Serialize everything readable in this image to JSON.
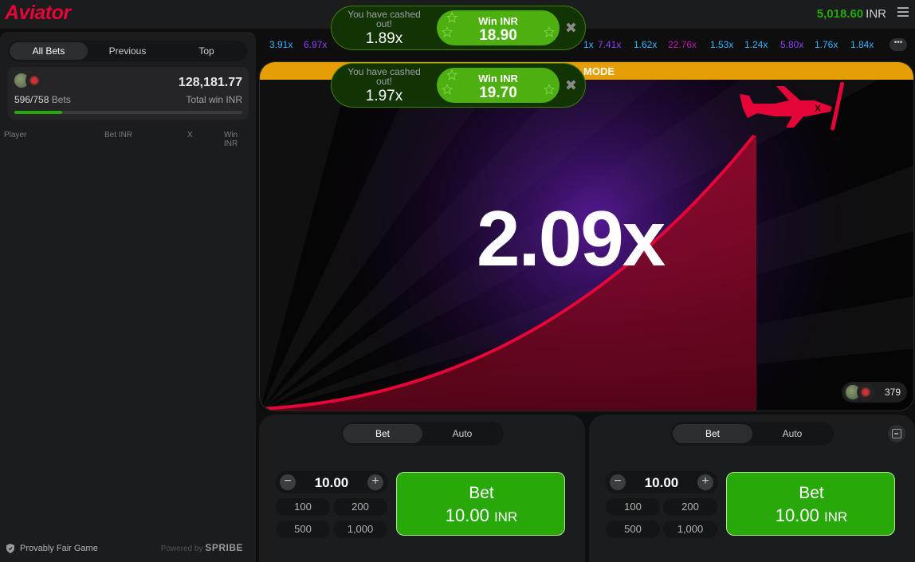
{
  "header": {
    "logo": "Aviator",
    "balance": "5,018.60",
    "currency": "INR"
  },
  "left_panel": {
    "tabs": [
      "All Bets",
      "Previous",
      "Top"
    ],
    "active_tab": "All Bets",
    "bets_count": "596/758",
    "bets_label": "Bets",
    "total_win": "128,181.77",
    "total_win_label": "Total win INR",
    "progress_fraction": 0.21,
    "columns": [
      "Player",
      "Bet INR",
      "X",
      "Win INR"
    ],
    "provably_fair": "Provably Fair Game",
    "powered_by": "Powered by",
    "brand": "SPRIBE"
  },
  "history": [
    {
      "value": "3.91x",
      "color": "#34b4ff"
    },
    {
      "value": "6.97x",
      "color": "#913ef8"
    },
    {
      "value": "1x",
      "color": "#34b4ff"
    },
    {
      "value": "7.41x",
      "color": "#913ef8"
    },
    {
      "value": "1.62x",
      "color": "#34b4ff"
    },
    {
      "value": "22.76x",
      "color": "#c017b4"
    },
    {
      "value": "1.53x",
      "color": "#34b4ff"
    },
    {
      "value": "1.24x",
      "color": "#34b4ff"
    },
    {
      "value": "5.80x",
      "color": "#913ef8"
    },
    {
      "value": "1.76x",
      "color": "#34b4ff"
    },
    {
      "value": "1.84x",
      "color": "#34b4ff"
    }
  ],
  "game": {
    "mode_text": "MODE",
    "multiplier": "2.09x",
    "online_players": "379"
  },
  "toasts": [
    {
      "label": "You have cashed out!",
      "multiplier": "1.89x",
      "win_label": "Win INR",
      "win_value": "18.90"
    },
    {
      "label": "You have cashed out!",
      "multiplier": "1.97x",
      "win_label": "Win INR",
      "win_value": "19.70"
    }
  ],
  "bet_panels": [
    {
      "tabs": [
        "Bet",
        "Auto"
      ],
      "active_tab": "Bet",
      "stake": "10.00",
      "quick": [
        "100",
        "200",
        "500",
        "1,000"
      ],
      "button_label": "Bet",
      "button_amount": "10.00",
      "button_currency": "INR"
    },
    {
      "tabs": [
        "Bet",
        "Auto"
      ],
      "active_tab": "Bet",
      "stake": "10.00",
      "quick": [
        "100",
        "200",
        "500",
        "1,000"
      ],
      "button_label": "Bet",
      "button_amount": "10.00",
      "button_currency": "INR"
    }
  ],
  "colors": {
    "brand_red": "#e50539",
    "win_green": "#28a909",
    "mode_orange": "#e59e05"
  }
}
